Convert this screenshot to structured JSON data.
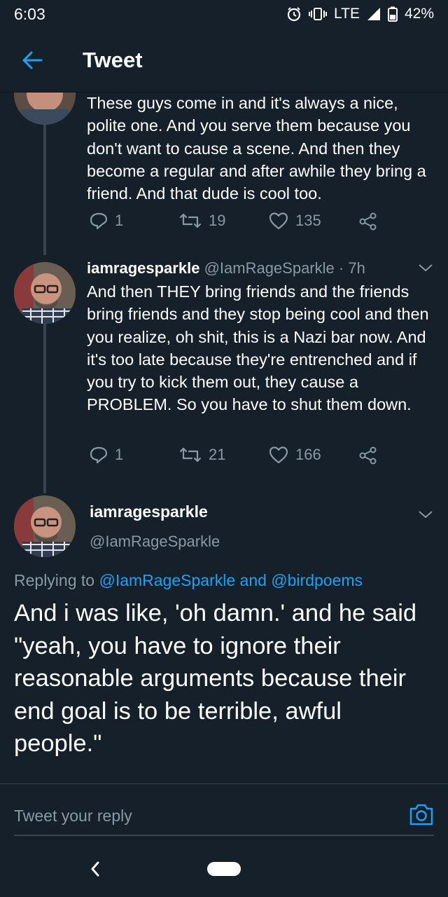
{
  "status_bar": {
    "time": "6:03",
    "network": "LTE",
    "battery": "42%",
    "icons": [
      "alarm-icon",
      "vibrate-icon",
      "signal-icon",
      "battery-icon"
    ]
  },
  "app_bar": {
    "title": "Tweet",
    "back_icon": "arrow-left-icon"
  },
  "thread": [
    {
      "text": "These guys come in and it's always a nice, polite one. And you serve them because you don't want to cause a scene. And then they become a regular and after awhile they bring a friend. And that dude is cool too.",
      "actions": {
        "replies": "1",
        "retweets": "19",
        "likes": "135"
      }
    },
    {
      "display_name": "iamragesparkle",
      "handle": "@IamRageSparkle",
      "time": "· 7h",
      "text": "And then THEY bring friends and the friends bring friends and they stop being cool and then you realize, oh shit, this is a Nazi bar now. And it's too late because they're entrenched and if you try to kick them out, they cause a PROBLEM. So you have to shut them down.",
      "actions": {
        "replies": "1",
        "retweets": "21",
        "likes": "166"
      }
    }
  ],
  "focused_tweet": {
    "display_name": "iamragesparkle",
    "handle": "@IamRageSparkle",
    "replying_prefix": "Replying to",
    "replying_user1": "@IamRageSparkle",
    "replying_and": "and",
    "replying_user2": "@birdpoems",
    "text": "And i was like, 'oh damn.' and he said \"yeah, you have to ignore their reasonable arguments because their end goal is to be terrible, awful people.\""
  },
  "reply_bar": {
    "placeholder": "Tweet your reply",
    "camera_icon": "camera-icon"
  },
  "colors": {
    "background": "#15202b",
    "accent": "#1da1f2",
    "muted": "#8899a6",
    "divider": "#38444d"
  }
}
